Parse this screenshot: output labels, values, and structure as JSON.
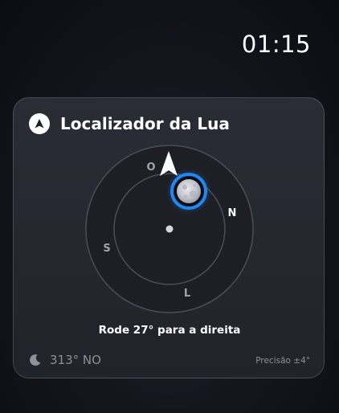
{
  "status": {
    "time": "01:15"
  },
  "widget": {
    "title": "Localizador da Lua",
    "app_icon": "navigation-arrow-icon",
    "compass": {
      "north": "N",
      "south": "S",
      "east": "L",
      "west": "O",
      "pointer_icon": "direction-arrow-icon",
      "moon_icon": "moon-target-icon",
      "center_icon": "center-dot-icon"
    },
    "instruction": "Rode 27° para a direita",
    "heading_icon": "crescent-moon-icon",
    "heading": "313° NO",
    "precision": "Precisão ±4°"
  },
  "colors": {
    "moon_ring": "#1e88f5",
    "card_background": "#26282f",
    "muted_text": "#8d9099"
  }
}
